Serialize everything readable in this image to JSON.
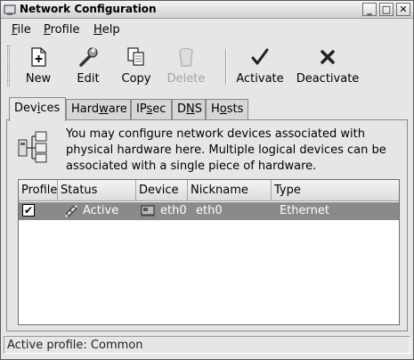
{
  "window": {
    "title": "Network Configuration",
    "controls": [
      "_",
      "□",
      "✕"
    ]
  },
  "menubar": {
    "items": [
      {
        "label": "File",
        "mnemonic_first": "F",
        "rest": "ile"
      },
      {
        "label": "Profile",
        "mnemonic_first": "P",
        "rest": "rofile"
      },
      {
        "label": "Help",
        "mnemonic_first": "H",
        "rest": "elp"
      }
    ]
  },
  "toolbar": {
    "new_label": "New",
    "edit_label": "Edit",
    "copy_label": "Copy",
    "delete_label": "Delete",
    "activate_label": "Activate",
    "deactivate_label": "Deactivate"
  },
  "tabs": [
    {
      "label": "Devices",
      "pre": "Dev",
      "u": "i",
      "post": "ces",
      "active": true
    },
    {
      "label": "Hardware",
      "pre": "Hard",
      "u": "w",
      "post": "are",
      "active": false
    },
    {
      "label": "IPsec",
      "pre": "IP",
      "u": "s",
      "post": "ec",
      "active": false
    },
    {
      "label": "DNS",
      "pre": "D",
      "u": "N",
      "post": "S",
      "active": false
    },
    {
      "label": "Hosts",
      "pre": "H",
      "u": "o",
      "post": "sts",
      "active": false
    }
  ],
  "devices_panel": {
    "info_line1": "You may configure network devices associated with",
    "info_line2": "physical hardware here.  Multiple logical devices can be",
    "info_line3": "associated with a single piece of hardware.",
    "columns": [
      "Profile",
      "Status",
      "Device",
      "Nickname",
      "Type"
    ],
    "rows": [
      {
        "profile_checked": true,
        "check_glyph": "✔",
        "status": "Active",
        "device": "eth0",
        "nickname": "eth0",
        "type": "Ethernet"
      }
    ]
  },
  "statusbar": {
    "text": "Active profile: Common"
  },
  "colors": {
    "selection": "#8a8a8a",
    "background": "#e6e6e6"
  }
}
